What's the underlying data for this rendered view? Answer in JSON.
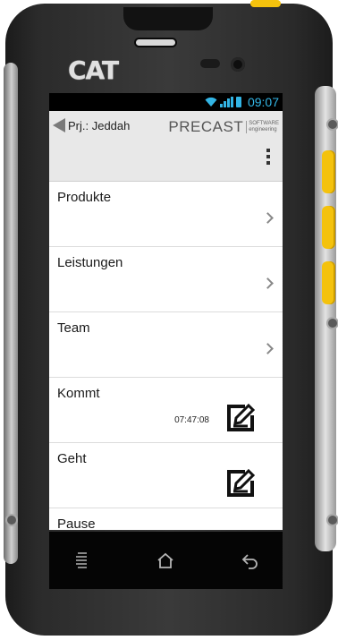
{
  "device": {
    "brand": "CAT"
  },
  "status_bar": {
    "time": "09:07"
  },
  "app_bar": {
    "project_label": "Prj.: Jeddah",
    "logo_main": "PRECAST",
    "logo_sub_line1": "SOFTWARE",
    "logo_sub_line2": "engineering"
  },
  "list": [
    {
      "label": "Produkte",
      "type": "nav"
    },
    {
      "label": "Leistungen",
      "type": "nav"
    },
    {
      "label": "Team",
      "type": "nav"
    },
    {
      "label": "Kommt",
      "type": "edit",
      "time": "07:47:08"
    },
    {
      "label": "Geht",
      "type": "edit",
      "time": ""
    },
    {
      "label": "Pause",
      "type": "field"
    }
  ],
  "icons": {
    "back": "back-arrow-icon",
    "overflow": "overflow-menu-icon",
    "chevron": "chevron-right-icon",
    "edit": "edit-note-icon",
    "nav_menu": "menu-icon",
    "nav_home": "home-icon",
    "nav_back": "back-icon"
  },
  "colors": {
    "accent": "#33b5e5",
    "phone_yellow": "#f4c20d"
  }
}
